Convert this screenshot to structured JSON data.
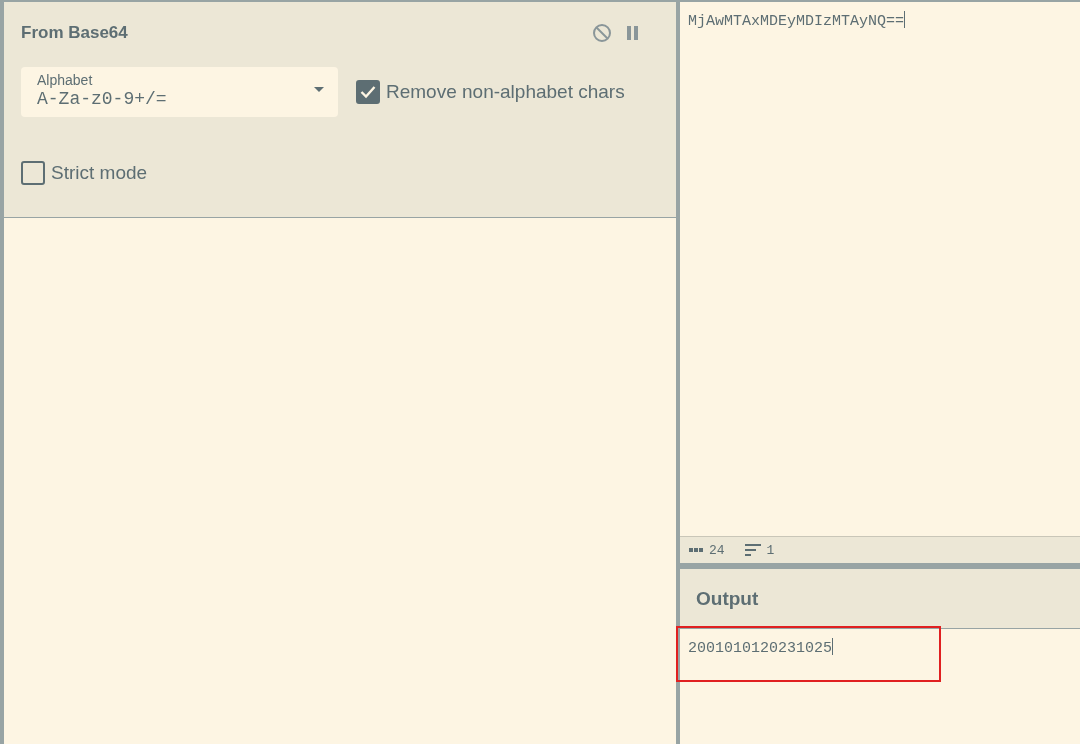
{
  "recipe": {
    "operation": {
      "title": "From Base64",
      "disabled": false,
      "paused": false,
      "alphabet": {
        "label": "Alphabet",
        "value": "A-Za-z0-9+/="
      },
      "options": [
        {
          "label": "Remove non-alphabet chars",
          "checked": true
        },
        {
          "label": "Strict mode",
          "checked": false
        }
      ]
    }
  },
  "input": {
    "value": "MjAwMTAxMDEyMDIzMTAyNQ==",
    "length": "24",
    "lines": "1"
  },
  "output": {
    "title": "Output",
    "value": "2001010120231025",
    "highlighted": true
  }
}
